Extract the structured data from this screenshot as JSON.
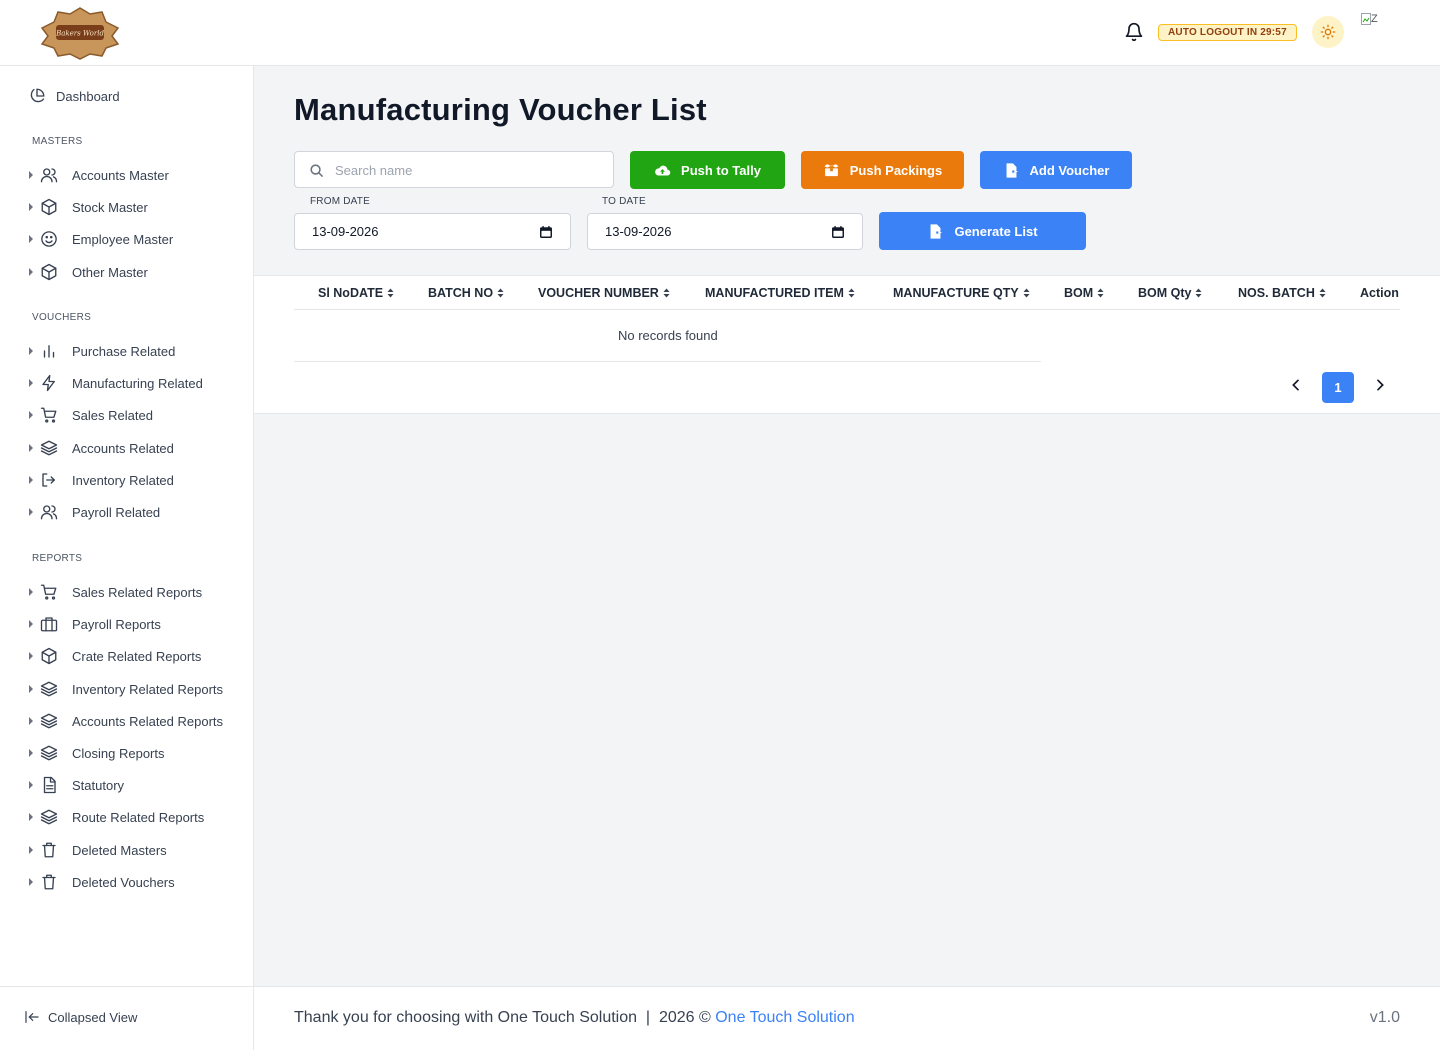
{
  "header": {
    "logo_text": "Bakers World",
    "logout_badge": "AUTO LOGOUT IN 29:57",
    "avatar_alt": "Z",
    "colors": {
      "logout_badge_bg": "#fef3c7",
      "theme_button_bg": "#fef3c7"
    }
  },
  "sidebar": {
    "dashboard": "Dashboard",
    "sections": {
      "masters": "MASTERS",
      "vouchers": "VOUCHERS",
      "reports": "REPORTS"
    },
    "masters": [
      {
        "label": "Accounts Master",
        "icon": "users-icon"
      },
      {
        "label": "Stock Master",
        "icon": "box-icon"
      },
      {
        "label": "Employee Master",
        "icon": "smile-icon"
      },
      {
        "label": "Other Master",
        "icon": "box-icon"
      }
    ],
    "vouchers": [
      {
        "label": "Purchase Related",
        "icon": "bar-chart-icon"
      },
      {
        "label": "Manufacturing Related",
        "icon": "lightning-icon"
      },
      {
        "label": "Sales Related",
        "icon": "cart-icon"
      },
      {
        "label": "Accounts Related",
        "icon": "layers-icon"
      },
      {
        "label": "Inventory Related",
        "icon": "logout-icon"
      },
      {
        "label": "Payroll Related",
        "icon": "users-icon"
      }
    ],
    "reports": [
      {
        "label": "Sales Related Reports",
        "icon": "cart-icon"
      },
      {
        "label": "Payroll Reports",
        "icon": "briefcase-icon"
      },
      {
        "label": "Crate Related Reports",
        "icon": "box-icon"
      },
      {
        "label": "Inventory Related Reports",
        "icon": "layers-icon"
      },
      {
        "label": "Accounts Related Reports",
        "icon": "layers-icon"
      },
      {
        "label": "Closing Reports",
        "icon": "layers-icon"
      },
      {
        "label": "Statutory",
        "icon": "document-icon"
      },
      {
        "label": "Route Related Reports",
        "icon": "layers-icon"
      },
      {
        "label": "Deleted Masters",
        "icon": "trash-icon"
      },
      {
        "label": "Deleted Vouchers",
        "icon": "trash-icon"
      }
    ],
    "collapse_label": "Collapsed View"
  },
  "main": {
    "title": "Manufacturing Voucher List",
    "search_placeholder": "Search name",
    "buttons": {
      "push_tally": "Push to Tally",
      "push_packings": "Push Packings",
      "add_voucher": "Add Voucher",
      "generate_list": "Generate List"
    },
    "colors": {
      "tally": "#22a512",
      "packings": "#ea7a0b",
      "primary": "#3b82f6"
    },
    "from_date_label": "FROM DATE",
    "from_date_value": "13-09-2026",
    "to_date_label": "TO DATE",
    "to_date_value": "13-09-2026"
  },
  "table": {
    "columns": [
      "Sl No",
      "DATE",
      "BATCH NO",
      "VOUCHER NUMBER",
      "MANUFACTURED ITEM",
      "MANUFACTURE QTY",
      "BOM",
      "BOM Qty",
      "NOS. BATCH",
      "Action"
    ],
    "rows": [],
    "empty_text": "No records found",
    "pagination": {
      "current_page": "1"
    }
  },
  "footer": {
    "thanks_text": "Thank you for choosing with One Touch Solution  |  2026 © ",
    "company_link": "One Touch Solution",
    "version": "v1.0"
  }
}
